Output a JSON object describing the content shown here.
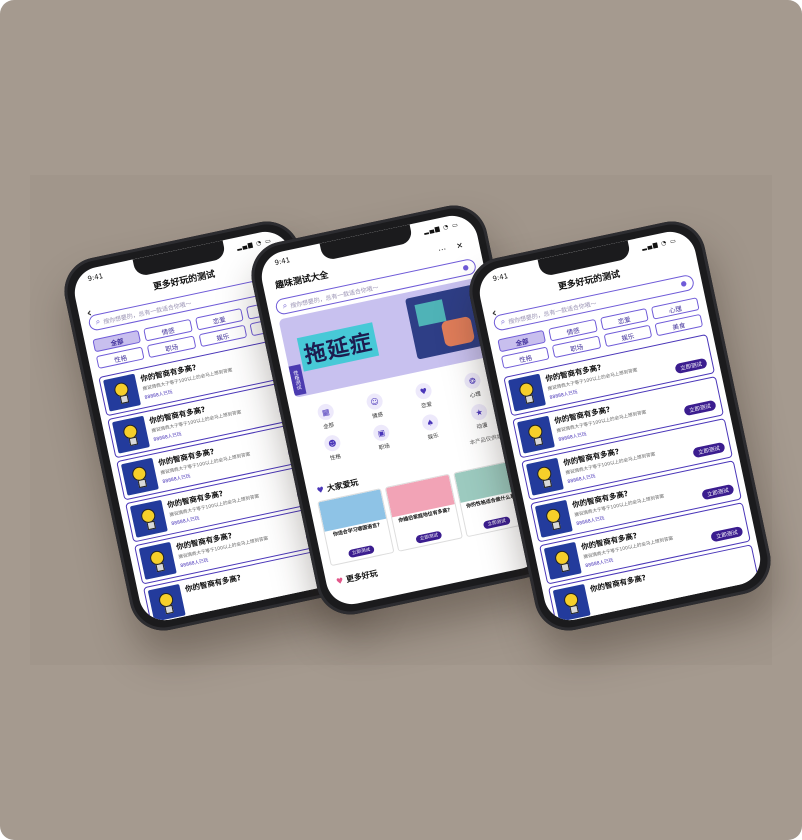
{
  "status_time": "9:41",
  "list_screen": {
    "title": "更多好玩的测试",
    "search_placeholder": "搜你想要的，总有一款适合你哦～",
    "chips": [
      {
        "label": "全部",
        "active": true
      },
      {
        "label": "情感",
        "active": false
      },
      {
        "label": "恋爱",
        "active": false
      },
      {
        "label": "心理",
        "active": false
      },
      {
        "label": "性格",
        "active": false
      },
      {
        "label": "职场",
        "active": false
      },
      {
        "label": "娱乐",
        "active": false
      },
      {
        "label": "美食",
        "active": false
      }
    ],
    "card": {
      "title": "你的智商有多高?",
      "desc": "据说情商大于等于100以上的会马上想到答案",
      "count": "88888人已玩",
      "button": "立即测试"
    }
  },
  "home_screen": {
    "title": "趣味测试大全",
    "search_placeholder": "搜你想要的，总有一款适合你哦～",
    "banner_text": "拖延症",
    "banner_tag": "性格测试",
    "categories": [
      {
        "label": "全部",
        "icon": "grid-icon"
      },
      {
        "label": "情感",
        "icon": "smile-icon"
      },
      {
        "label": "恋爱",
        "icon": "heart-icon"
      },
      {
        "label": "心理",
        "icon": "brain-icon"
      },
      {
        "label": "性格",
        "icon": "face-icon"
      },
      {
        "label": "职场",
        "icon": "briefcase-icon"
      },
      {
        "label": "娱乐",
        "icon": "game-icon"
      },
      {
        "label": "动漫",
        "icon": "star-icon"
      }
    ],
    "slogan": "本产品仅供娱乐",
    "popular_title": "大家爱玩",
    "popular": [
      {
        "title": "你适合学习哪国语言?",
        "button": "立即测试",
        "color": "#8ec3e6"
      },
      {
        "title": "你婚后家庭地位有多高?",
        "button": "立即测试",
        "color": "#f2a3b6"
      },
      {
        "title": "你的性格适合做什么事?",
        "button": "立即测试",
        "color": "#9ccabf"
      }
    ],
    "more_title": "更多好玩"
  },
  "colors": {
    "accent": "#4a36b9",
    "button": "#3b1d8f",
    "background": "#a59a8f"
  }
}
